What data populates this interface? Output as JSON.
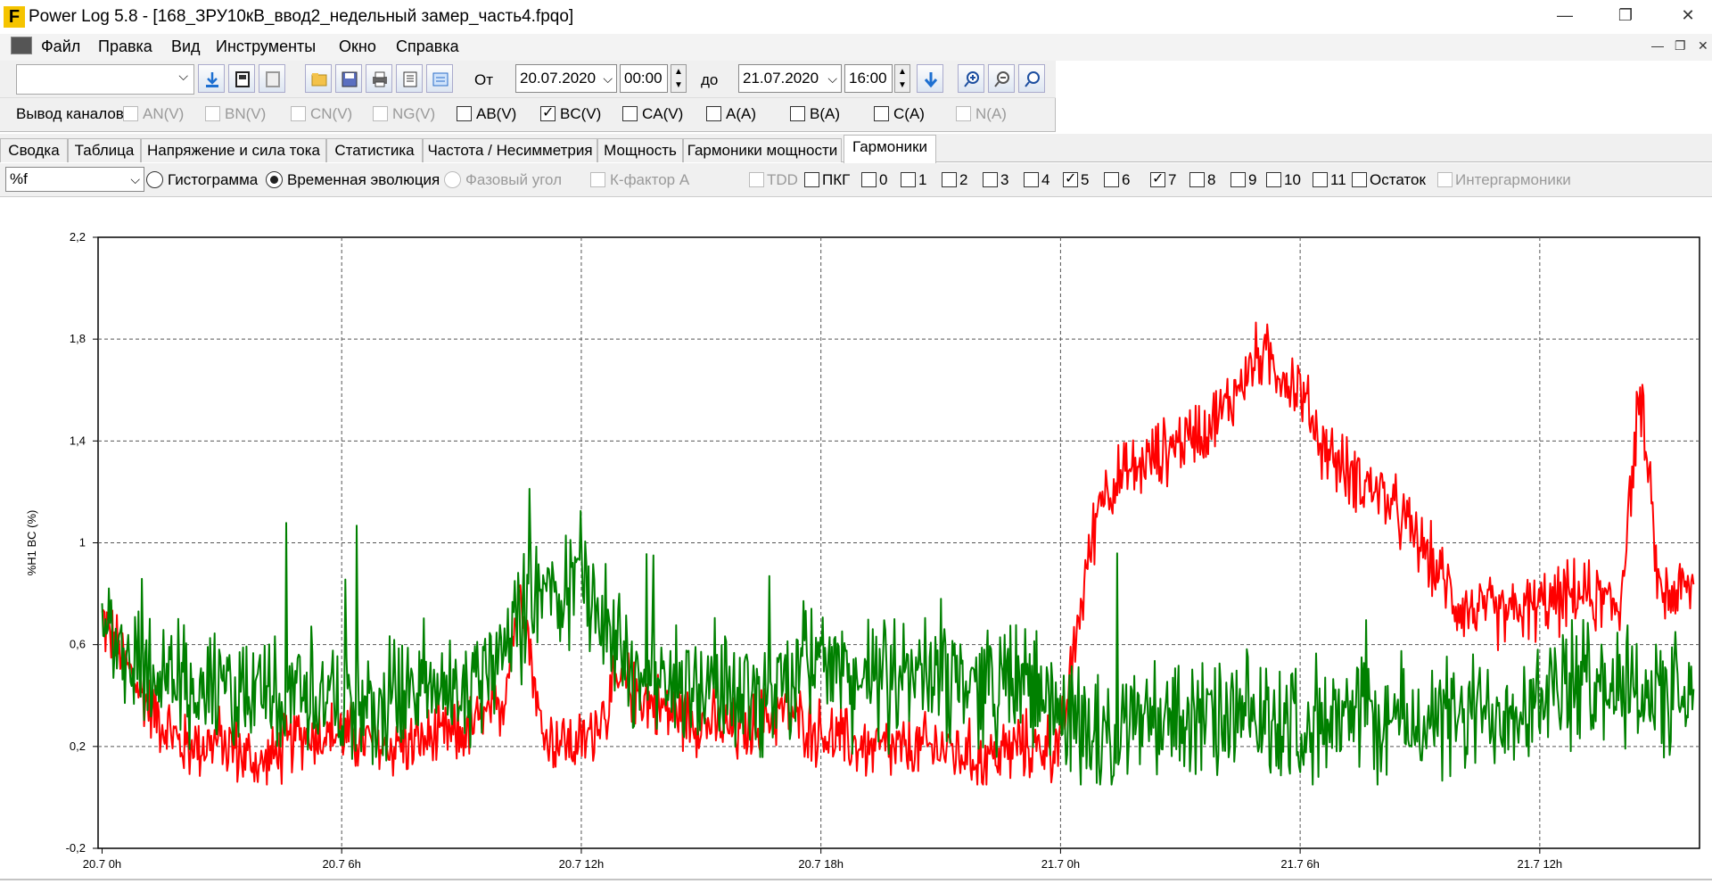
{
  "window": {
    "title": "Power Log 5.8 - [168_ЗРУ10кВ_ввод2_недельный замер_часть4.fpqo]",
    "logo_letter": "F",
    "controls": {
      "minimize": "—",
      "restore": "❐",
      "close": "✕"
    }
  },
  "menu": {
    "items": [
      "Файл",
      "Правка",
      "Вид",
      "Инструменты",
      "Окно",
      "Справка"
    ],
    "mdi_controls": {
      "minimize": "—",
      "restore": "❐",
      "close": "✕"
    }
  },
  "toolbar": {
    "profile_select": "",
    "from_label": "От",
    "from_date": "20.07.2020",
    "from_time": "00:00",
    "to_label": "до",
    "to_date": "21.07.2020",
    "to_time": "16:00"
  },
  "channels": {
    "label": "Вывод каналов",
    "items": [
      {
        "label": "AN(V)",
        "checked": false,
        "enabled": false
      },
      {
        "label": "BN(V)",
        "checked": false,
        "enabled": false
      },
      {
        "label": "CN(V)",
        "checked": false,
        "enabled": false
      },
      {
        "label": "NG(V)",
        "checked": false,
        "enabled": false
      },
      {
        "label": "AB(V)",
        "checked": false,
        "enabled": true
      },
      {
        "label": "BC(V)",
        "checked": true,
        "enabled": true
      },
      {
        "label": "CA(V)",
        "checked": false,
        "enabled": true
      },
      {
        "label": "A(A)",
        "checked": false,
        "enabled": true
      },
      {
        "label": "B(A)",
        "checked": false,
        "enabled": true
      },
      {
        "label": "C(A)",
        "checked": false,
        "enabled": true
      },
      {
        "label": "N(A)",
        "checked": false,
        "enabled": false
      }
    ]
  },
  "tabs": [
    {
      "label": "Сводка",
      "active": false
    },
    {
      "label": "Таблица",
      "active": false
    },
    {
      "label": "Напряжение и сила тока",
      "active": false
    },
    {
      "label": "Статистика",
      "active": false
    },
    {
      "label": "Частота / Несимметрия",
      "active": false
    },
    {
      "label": "Мощность",
      "active": false
    },
    {
      "label": "Гармоники мощности",
      "active": false
    },
    {
      "label": "Гармоники",
      "active": true
    }
  ],
  "harmonics_controls": {
    "unit_select": "%f",
    "modes": [
      {
        "label": "Гистограмма",
        "selected": false,
        "enabled": true
      },
      {
        "label": "Временная эволюция",
        "selected": true,
        "enabled": true
      },
      {
        "label": "Фазовый угол",
        "selected": false,
        "enabled": false
      }
    ],
    "k_factor": "К-фактор А",
    "orders": [
      {
        "label": "TDD",
        "checked": false,
        "enabled": false
      },
      {
        "label": "ПКГ",
        "checked": false,
        "enabled": true
      },
      {
        "label": "0",
        "checked": false,
        "enabled": true
      },
      {
        "label": "1",
        "checked": false,
        "enabled": true
      },
      {
        "label": "2",
        "checked": false,
        "enabled": true
      },
      {
        "label": "3",
        "checked": false,
        "enabled": true
      },
      {
        "label": "4",
        "checked": false,
        "enabled": true
      },
      {
        "label": "5",
        "checked": true,
        "enabled": true
      },
      {
        "label": "6",
        "checked": false,
        "enabled": true
      },
      {
        "label": "7",
        "checked": true,
        "enabled": true
      },
      {
        "label": "8",
        "checked": false,
        "enabled": true
      },
      {
        "label": "9",
        "checked": false,
        "enabled": true
      },
      {
        "label": "10",
        "checked": false,
        "enabled": true
      },
      {
        "label": "11",
        "checked": false,
        "enabled": true
      },
      {
        "label": "Остаток",
        "checked": false,
        "enabled": true
      },
      {
        "label": "Интергармоники",
        "checked": false,
        "enabled": false
      }
    ]
  },
  "chart_data": {
    "type": "line",
    "title": "",
    "xlabel": "",
    "ylabel": "%H1 BC (%)",
    "y_ticks": [
      "-0,2",
      "0,2",
      "0,6",
      "1",
      "1,4",
      "1,8",
      "2,2"
    ],
    "ylim": [
      -0.2,
      2.2
    ],
    "x_ticks": [
      "20.7 0h",
      "20.7 6h",
      "20.7 12h",
      "20.7 18h",
      "21.7 0h",
      "21.7 6h",
      "21.7 12h"
    ],
    "x_unit": "hours since 20.07.2020 00:00",
    "xlim": [
      -0.1,
      40.0
    ],
    "grid": true,
    "series": [
      {
        "name": "",
        "color": "#ff0000",
        "x": [
          0,
          1,
          2,
          3,
          4,
          5,
          6,
          7,
          8,
          9,
          10,
          10.5,
          11,
          12,
          13,
          14,
          15,
          16,
          17,
          18,
          19,
          20,
          21,
          22,
          23,
          24,
          24.5,
          25,
          26,
          27,
          28,
          29,
          30,
          30.5,
          31,
          32,
          33,
          34,
          35,
          36,
          37,
          38,
          38.5,
          39,
          40
        ],
        "y": [
          0.7,
          0.4,
          0.2,
          0.22,
          0.12,
          0.25,
          0.25,
          0.2,
          0.22,
          0.25,
          0.35,
          0.85,
          0.25,
          0.2,
          0.45,
          0.35,
          0.3,
          0.25,
          0.35,
          0.25,
          0.2,
          0.18,
          0.2,
          0.15,
          0.2,
          0.2,
          0.75,
          1.2,
          1.3,
          1.4,
          1.5,
          1.75,
          1.6,
          1.4,
          1.3,
          1.2,
          1.0,
          0.75,
          0.72,
          0.75,
          0.8,
          0.75,
          1.6,
          0.8,
          0.82
        ]
      },
      {
        "name": "",
        "color": "#008000",
        "x": [
          0,
          1,
          2,
          3,
          4,
          5,
          6,
          7,
          8,
          9,
          10,
          11,
          12,
          13,
          14,
          15,
          16,
          17,
          18,
          19,
          20,
          21,
          22,
          23,
          24,
          25,
          26,
          27,
          28,
          29,
          30,
          31,
          32,
          33,
          34,
          35,
          36,
          37,
          38,
          39,
          40
        ],
        "y": [
          0.7,
          0.5,
          0.45,
          0.4,
          0.4,
          0.45,
          0.35,
          0.35,
          0.45,
          0.4,
          0.6,
          0.8,
          0.85,
          0.55,
          0.45,
          0.45,
          0.4,
          0.45,
          0.55,
          0.45,
          0.45,
          0.5,
          0.45,
          0.45,
          0.35,
          0.25,
          0.3,
          0.3,
          0.3,
          0.3,
          0.3,
          0.3,
          0.3,
          0.3,
          0.3,
          0.35,
          0.4,
          0.45,
          0.45,
          0.4,
          0.35
        ]
      }
    ]
  }
}
